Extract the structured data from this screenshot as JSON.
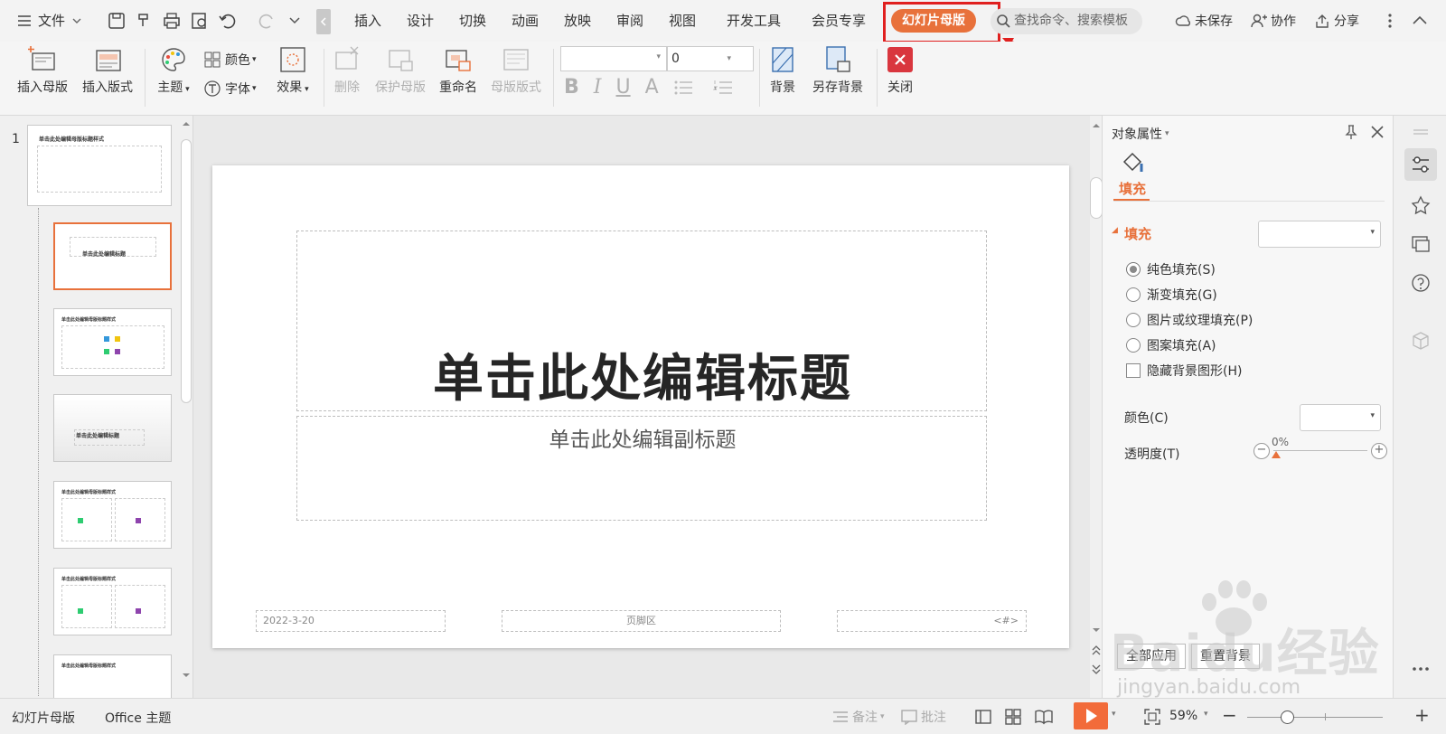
{
  "menubar": {
    "file_label": "文件",
    "tabs": [
      "插入",
      "设计",
      "切换",
      "动画",
      "放映",
      "审阅",
      "视图",
      "开发工具",
      "会员专享"
    ],
    "active_tab": "幻灯片母版",
    "search_placeholder": "查找命令、搜索模板",
    "unsaved_label": "未保存",
    "collab_label": "协作",
    "share_label": "分享"
  },
  "ribbon": {
    "insert_master": "插入母版",
    "insert_layout": "插入版式",
    "theme": "主题",
    "color": "颜色",
    "font": "字体",
    "effect": "效果",
    "delete": "删除",
    "protect_master": "保护母版",
    "rename": "重命名",
    "master_layout": "母版版式",
    "font_size_value": "0",
    "background": "背景",
    "save_background": "另存背景",
    "close": "关闭"
  },
  "thumbnails": {
    "slide_number": "1",
    "master_title": "单击此处编辑母版标题样式",
    "title_layout": "单击此处编辑标题",
    "content_title": "单击此处编辑母版标题样式"
  },
  "slide": {
    "title": "单击此处编辑标题",
    "subtitle": "单击此处编辑副标题",
    "date": "2022-3-20",
    "footer": "页脚区",
    "number": "<#>"
  },
  "properties": {
    "header": "对象属性",
    "tab_fill": "填充",
    "section_fill": "填充",
    "options": [
      "纯色填充(S)",
      "渐变填充(G)",
      "图片或纹理填充(P)",
      "图案填充(A)"
    ],
    "selected_option": "纯色填充(S)",
    "hide_bg_label": "隐藏背景图形(H)",
    "color_label": "颜色(C)",
    "transparency_label": "透明度(T)",
    "transparency_value": "0%",
    "apply_all": "全部应用",
    "reset_bg": "重置背景"
  },
  "statusbar": {
    "view_name": "幻灯片母版",
    "theme_name": "Office 主题",
    "notes": "备注",
    "comments": "批注",
    "zoom": "59%"
  },
  "watermark": "Baidu经验",
  "watermark_url": "jingyan.baidu.com",
  "colors": {
    "accent": "#e8713b",
    "annotation_red": "#e0201f",
    "close_red": "#d9363e",
    "play_orange": "#f26b3a"
  }
}
